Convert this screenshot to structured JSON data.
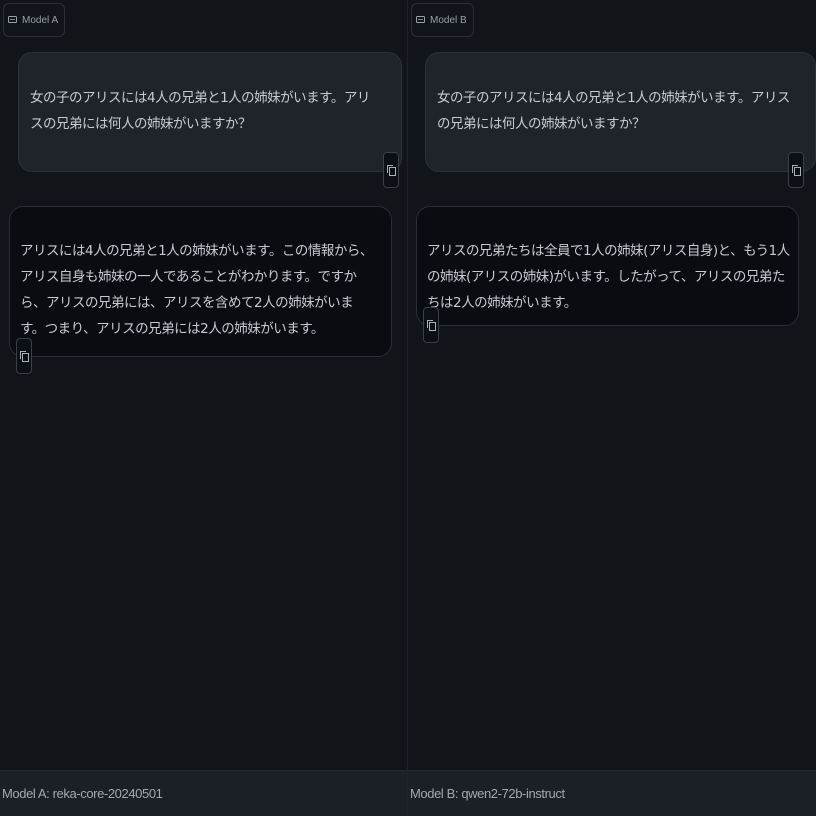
{
  "panels": [
    {
      "tag": "Model A",
      "question": "女の子のアリスには4人の兄弟と1人の姉妹がいます。アリスの兄弟には何人の姉妹がいますか？",
      "answer": "アリスには4人の兄弟と1人の姉妹がいます。この情報から、アリス自身も姉妹の一人であることがわかります。ですから、アリスの兄弟には、アリスを含めて2人の姉妹がいます。つまり、アリスの兄弟には2人の姉妹がいます。",
      "footer": "Model A: reka-core-20240501"
    },
    {
      "tag": "Model B",
      "question": "女の子のアリスには4人の兄弟と1人の姉妹がいます。アリスの兄弟には何人の姉妹がいますか？",
      "answer": "アリスの兄弟たちは全員で1人の姉妹(アリス自身)と、もう1人の姉妹(アリスの姉妹)がいます。したがって、アリスの兄弟たちは2人の姉妹がいます。",
      "footer": "Model B: qwen2-72b-instruct"
    }
  ],
  "icons": {
    "tag": "chat-icon",
    "copy": "copy-icon"
  }
}
